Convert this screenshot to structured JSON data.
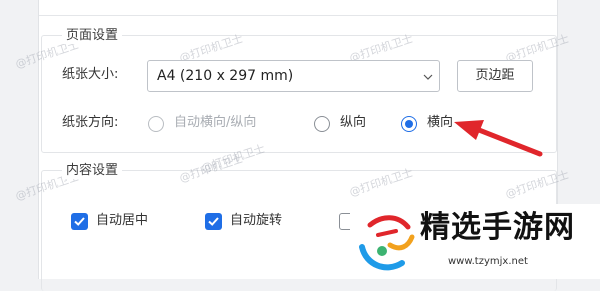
{
  "page_settings": {
    "section_title": "页面设置",
    "paper_size_label": "纸张大小:",
    "paper_size_value": "A4 (210 x 297 mm)",
    "margins_button": "页边距",
    "orientation_label": "纸张方向:",
    "orientation_options": [
      {
        "label": "自动横向/纵向",
        "state": "disabled"
      },
      {
        "label": "纵向",
        "state": "unchecked"
      },
      {
        "label": "横向",
        "state": "checked"
      }
    ]
  },
  "content_settings": {
    "section_title": "内容设置",
    "options": [
      {
        "label": "自动居中",
        "checked": true
      },
      {
        "label": "自动旋转",
        "checked": true
      }
    ]
  },
  "watermarks": [
    "@打印机卫士",
    "@打印机卫士",
    "@打印机卫士",
    "@打印机卫士",
    "@打印机卫士",
    "@打印机卫士",
    "@打印机卫士",
    "@打印机卫士",
    "@打印机卫士"
  ],
  "logo": {
    "brand": "精选手游网",
    "url": "www.tzymjx.net"
  },
  "colors": {
    "accent": "#1f6ee6",
    "annotation_arrow": "#e0262b"
  }
}
